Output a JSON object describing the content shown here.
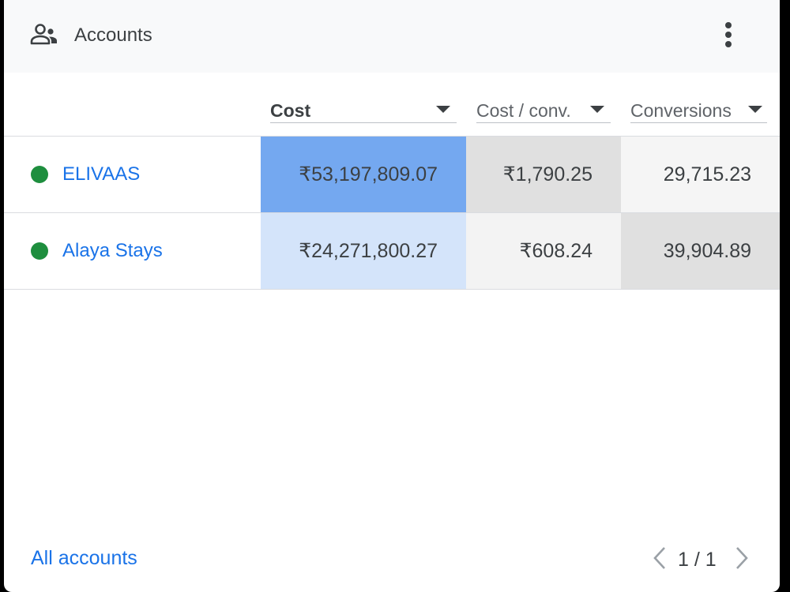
{
  "header": {
    "title": "Accounts",
    "icon": "group-icon",
    "menu_icon": "more-vert-icon"
  },
  "columns": [
    {
      "label": "Cost",
      "sorted": true
    },
    {
      "label": "Cost / conv.",
      "sorted": false
    },
    {
      "label": "Conversions",
      "sorted": false
    }
  ],
  "rows": [
    {
      "name": "ELIVAAS",
      "status": "enabled",
      "cost": "₹53,197,809.07",
      "cost_per_conv": "₹1,790.25",
      "conversions": "29,715.23",
      "cost_shade": "#74a8f0",
      "cpc_shade": "#e0e0e0",
      "conv_shade": "#f5f5f5"
    },
    {
      "name": "Alaya Stays",
      "status": "enabled",
      "cost": "₹24,271,800.27",
      "cost_per_conv": "₹608.24",
      "conversions": "39,904.89",
      "cost_shade": "#d4e4fa",
      "cpc_shade": "#f3f3f3",
      "conv_shade": "#e0e0e0"
    }
  ],
  "footer": {
    "link": "All accounts",
    "pager": "1 / 1"
  },
  "colors": {
    "accent": "#1a73e8",
    "status_enabled": "#1e8e3e",
    "header_bg": "#f8f9fa"
  }
}
